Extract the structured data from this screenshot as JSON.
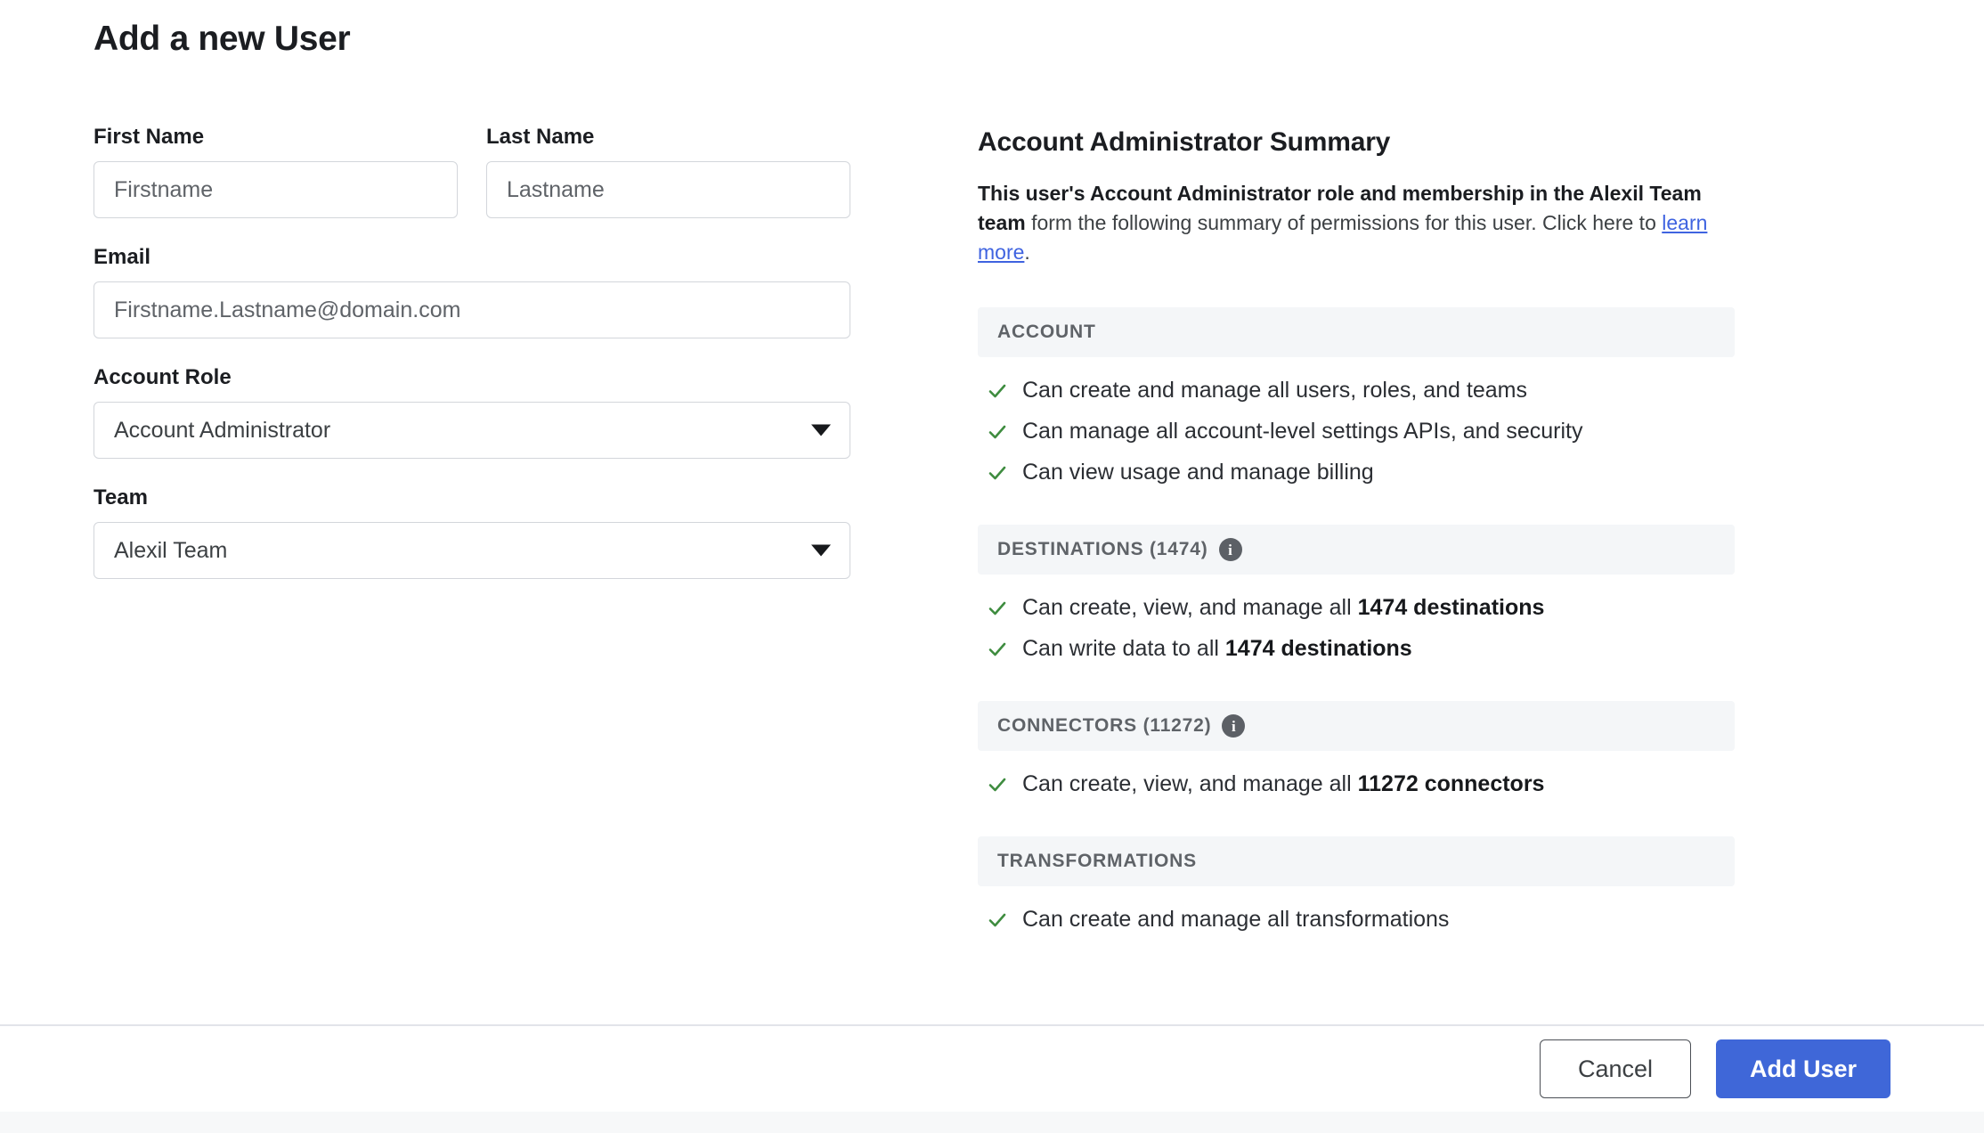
{
  "page_title": "Add a new User",
  "form": {
    "first_name": {
      "label": "First Name",
      "placeholder": "Firstname",
      "value": ""
    },
    "last_name": {
      "label": "Last Name",
      "placeholder": "Lastname",
      "value": ""
    },
    "email": {
      "label": "Email",
      "placeholder": "Firstname.Lastname@domain.com",
      "value": ""
    },
    "account_role": {
      "label": "Account Role",
      "selected": "Account Administrator"
    },
    "team": {
      "label": "Team",
      "selected": "Alexil Team"
    }
  },
  "summary": {
    "title": "Account Administrator Summary",
    "desc_bold_1": "This user's Account Administrator role and membership in the Alexil",
    "desc_bold_2": "Team team",
    "desc_rest_1": " form the following summary of permissions for this user. Click",
    "desc_rest_2": "here to ",
    "link_text": "learn more",
    "desc_end": ".",
    "sections": [
      {
        "title": "ACCOUNT",
        "has_info_icon": false,
        "items": [
          {
            "pre": "Can create and manage all users, roles, and teams",
            "bold": "",
            "post": ""
          },
          {
            "pre": "Can manage all account-level settings APIs, and security",
            "bold": "",
            "post": ""
          },
          {
            "pre": "Can view usage and manage billing",
            "bold": "",
            "post": ""
          }
        ]
      },
      {
        "title": "DESTINATIONS (1474)",
        "has_info_icon": true,
        "items": [
          {
            "pre": "Can create, view, and manage all ",
            "bold": "1474 destinations",
            "post": ""
          },
          {
            "pre": "Can write data to all ",
            "bold": "1474 destinations",
            "post": ""
          }
        ]
      },
      {
        "title": "CONNECTORS (11272)",
        "has_info_icon": true,
        "items": [
          {
            "pre": "Can create, view, and manage all ",
            "bold": "11272 connectors",
            "post": ""
          }
        ]
      },
      {
        "title": "TRANSFORMATIONS",
        "has_info_icon": false,
        "items": [
          {
            "pre": "Can create and manage all transformations",
            "bold": "",
            "post": ""
          }
        ]
      }
    ]
  },
  "footer": {
    "cancel_label": "Cancel",
    "submit_label": "Add User"
  },
  "icons": {
    "info": "i",
    "check": "check-icon",
    "caret": "chevron-down-icon"
  },
  "colors": {
    "primary_button": "#3f67d8",
    "link": "#3f63e0",
    "check_green": "#3e8c3f",
    "section_header_bg": "#f4f6f8",
    "info_icon_bg": "#5c6066"
  }
}
